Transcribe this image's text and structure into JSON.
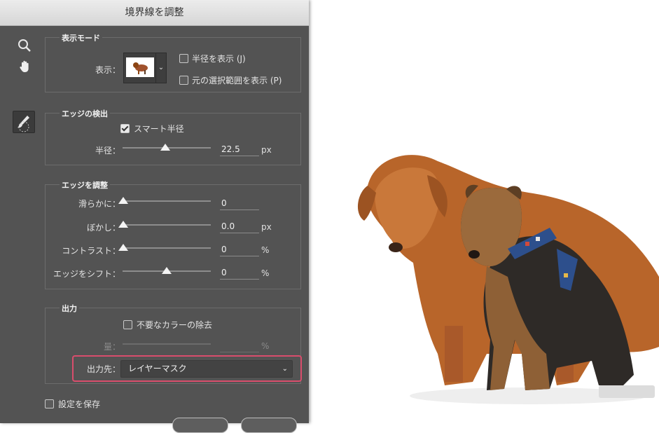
{
  "dialog": {
    "title": "境界線を調整"
  },
  "tools": {
    "zoom_icon": "search-icon",
    "hand_icon": "hand-icon",
    "brush_icon": "refine-brush-icon"
  },
  "view_mode": {
    "title": "表示モード",
    "view_label": "表示：",
    "show_radius_label": "半径を表示 (J)",
    "show_radius_checked": false,
    "show_original_label": "元の選択範囲を表示 (P)",
    "show_original_checked": false
  },
  "edge_detection": {
    "title": "エッジの検出",
    "smart_radius_label": "スマート半径",
    "smart_radius_checked": true,
    "radius_label": "半径：",
    "radius_value": "22.5",
    "radius_unit": "px"
  },
  "adjust_edge": {
    "title": "エッジを調整",
    "smooth_label": "滑らかに：",
    "smooth_value": "0",
    "feather_label": "ぼかし：",
    "feather_value": "0.0",
    "feather_unit": "px",
    "contrast_label": "コントラスト：",
    "contrast_value": "0",
    "contrast_unit": "%",
    "shift_label": "エッジをシフト：",
    "shift_value": "0",
    "shift_unit": "%"
  },
  "output": {
    "title": "出力",
    "decontaminate_label": "不要なカラーの除去",
    "decontaminate_checked": false,
    "amount_label": "量：",
    "amount_unit": "%",
    "output_to_label": "出力先：",
    "output_to_value": "レイヤーマスク"
  },
  "remember": {
    "label": "設定を保存",
    "checked": false
  },
  "colors": {
    "dialog_bg": "#535353",
    "highlight": "#d94d6c"
  }
}
